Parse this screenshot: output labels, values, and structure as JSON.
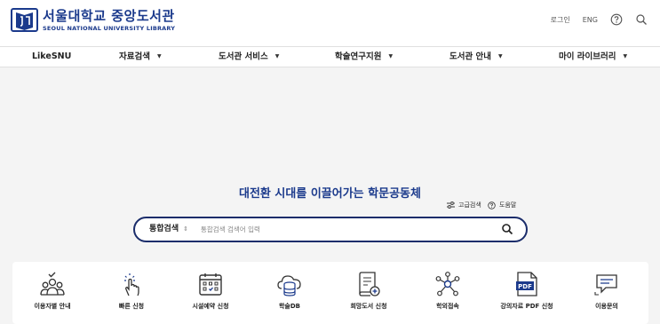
{
  "header": {
    "logo_kr": "서울대학교 중앙도서관",
    "logo_en": "SEOUL NATIONAL UNIVERSITY LIBRARY",
    "login": "로그인",
    "lang": "ENG"
  },
  "nav": {
    "items": [
      {
        "label": "LikeSNU"
      },
      {
        "label": "자료검색"
      },
      {
        "label": "도서관 서비스"
      },
      {
        "label": "학술연구지원"
      },
      {
        "label": "도서관 안내"
      },
      {
        "label": "마이 라이브러리"
      }
    ]
  },
  "hero": {
    "title": "대전환 시대를 이끌어가는 학문공동체",
    "advanced_search": "고급검색",
    "help": "도움말"
  },
  "search": {
    "type": "통합검색",
    "placeholder": "통합검색 검색어 입력",
    "value": ""
  },
  "quick": {
    "items": [
      {
        "label": "이용자별 안내",
        "icon": "users-icon"
      },
      {
        "label": "빠른 신청",
        "icon": "tap-hand-icon"
      },
      {
        "label": "시설예약 신청",
        "icon": "calendar-icon"
      },
      {
        "label": "학술DB",
        "icon": "cloud-database-icon"
      },
      {
        "label": "희망도서 신청",
        "icon": "book-add-icon"
      },
      {
        "label": "학외접속",
        "icon": "network-icon"
      },
      {
        "label": "강의자료 PDF 신청",
        "icon": "pdf-file-icon"
      },
      {
        "label": "이용문의",
        "icon": "chat-icon"
      }
    ]
  },
  "colors": {
    "brand": "#1b3a8c",
    "search_border": "#1b2d6b",
    "background": "#f4f4f4"
  }
}
